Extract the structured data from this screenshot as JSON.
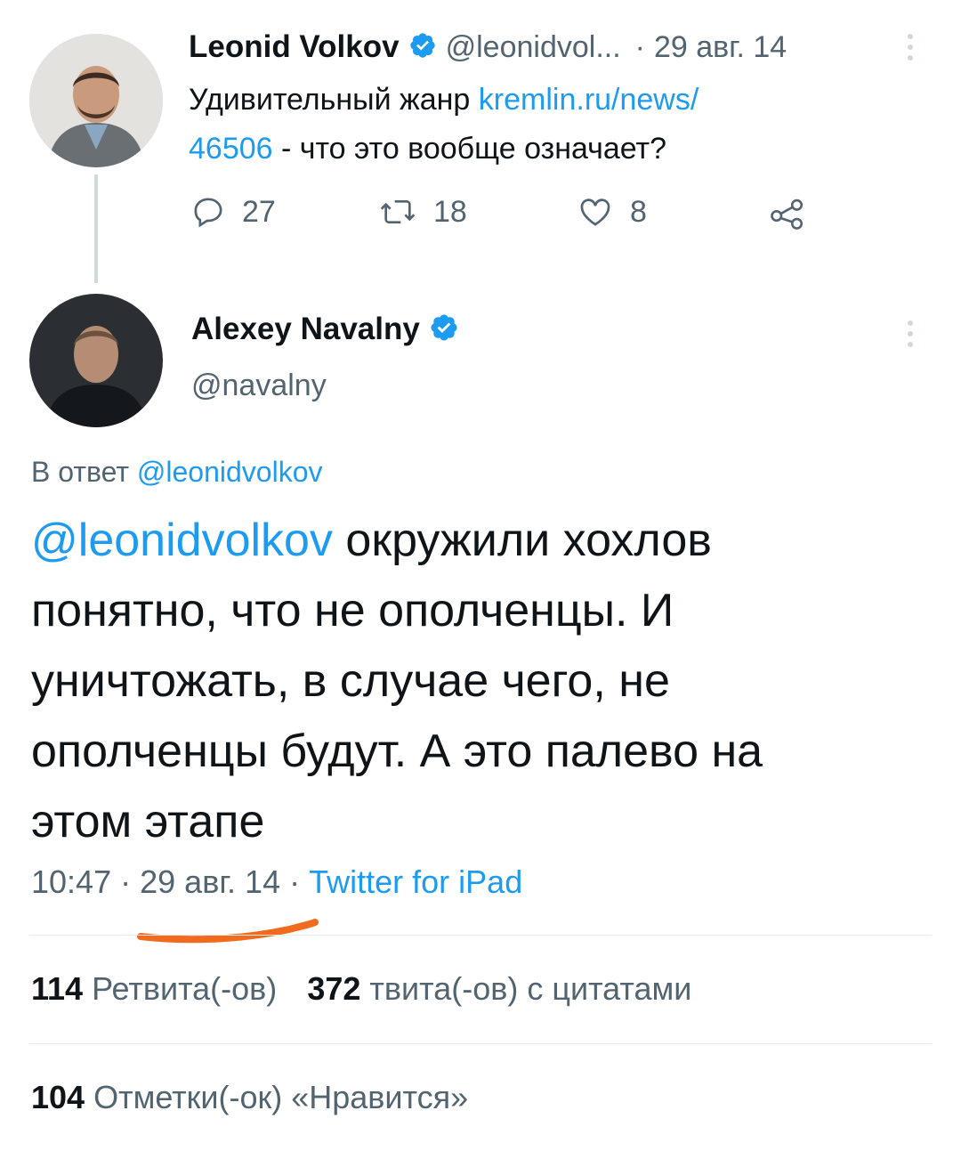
{
  "parent_tweet": {
    "author_name": "Leonid Volkov",
    "handle": "@leonidvol...",
    "separator": "·",
    "date": "29 авг. 14",
    "text_prefix": "Удивительный жанр ",
    "link_part1": "kremlin.ru/news/",
    "link_part2": "46506",
    "text_suffix": " - что это вообще означает?",
    "actions": {
      "reply_count": "27",
      "retweet_count": "18",
      "like_count": "8"
    }
  },
  "main_tweet": {
    "author_name": "Alexey Navalny",
    "handle": "@navalny",
    "reply_to_label": "В ответ ",
    "reply_to_handle": "@leonidvolkov",
    "mention": "@leonidvolkov",
    "body_line1": " окружили хохлов",
    "body_line2": "понятно, что не ополченцы. И",
    "body_line3": "уничтожать, в случае чего, не",
    "body_line4": "ополченцы будут. А это палево на",
    "body_line5": "этом этапе",
    "time": "10:47",
    "separator": "·",
    "date": "29 авг. 14",
    "separator2": "·",
    "source": "Twitter for iPad"
  },
  "stats": {
    "retweets_count": "114",
    "retweets_label": "Ретвита(-ов)",
    "quotes_count": "372",
    "quotes_label": "твита(-ов) с цитатами",
    "likes_count": "104",
    "likes_label": "Отметки(-ок) «Нравится»"
  },
  "colors": {
    "accent": "#1d9bf0",
    "secondary_text": "#536471",
    "annotation_underline": "#f26b1d"
  }
}
